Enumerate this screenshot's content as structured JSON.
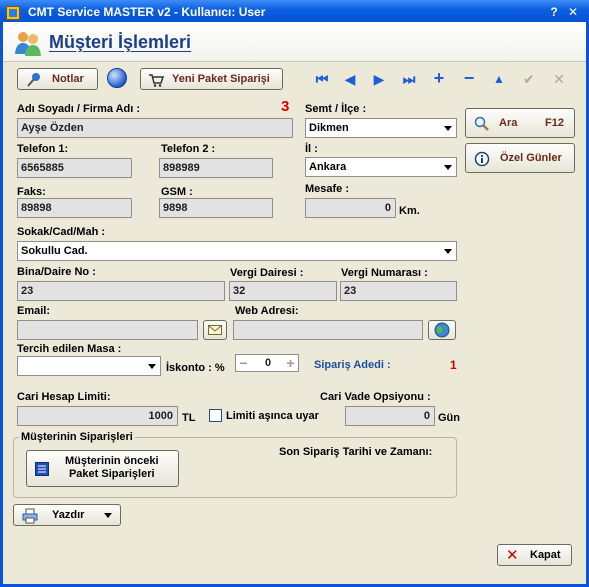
{
  "window": {
    "title": "CMT Service MASTER v2  -   Kullanıcı: User",
    "help": "?",
    "close": "✕"
  },
  "header": {
    "title": "Müşteri İşlemleri"
  },
  "toolbar": {
    "notes_label": "Notlar",
    "new_order_label": "Yeni Paket Siparişi",
    "nav": {
      "first": "⏮",
      "prev": "◀",
      "next": "▶",
      "last": "⏭",
      "add": "+",
      "remove": "−",
      "up": "▲",
      "confirm": "✔",
      "cancel": "✕"
    }
  },
  "form": {
    "name_label": "Adı Soyadı / Firma Adı :",
    "name_value": "Ayşe Özden",
    "count_badge": "3",
    "district_label": "Semt / İlçe :",
    "district_value": "Dikmen",
    "phone1_label": "Telefon 1:",
    "phone1_value": "6565885",
    "phone2_label": "Telefon 2 :",
    "phone2_value": "898989",
    "city_label": "İl :",
    "city_value": "Ankara",
    "fax_label": "Faks:",
    "fax_value": "89898",
    "gsm_label": "GSM :",
    "gsm_value": "9898",
    "distance_label": "Mesafe :",
    "distance_value": "0",
    "distance_unit": "Km.",
    "street_label": "Sokak/Cad/Mah :",
    "street_value": "Sokullu Cad.",
    "building_label": "Bina/Daire No :",
    "building_value": "23",
    "tax_office_label": "Vergi Dairesi :",
    "tax_office_value": "32",
    "tax_number_label": "Vergi Numarası :",
    "tax_number_value": "23",
    "email_label": "Email:",
    "email_value": "",
    "web_label": "Web Adresi:",
    "web_value": "",
    "table_label": "Tercih edilen Masa :",
    "table_value": "",
    "discount_label": "İskonto : %",
    "discount_value": "0",
    "order_count_label": "Sipariş Adedi :",
    "order_count_value": "1",
    "credit_limit_label": "Cari Hesap Limiti:",
    "credit_limit_value": "1000",
    "credit_unit": "TL",
    "limit_warn_label": "Limiti aşınca uyar",
    "due_label": "Cari Vade Opsiyonu :",
    "due_value": "0",
    "due_unit": "Gün"
  },
  "side_buttons": {
    "search_label": "Ara",
    "search_shortcut": "F12",
    "special_days_label": "Özel Günler"
  },
  "orders_group": {
    "title": "Müşterinin Siparişleri",
    "prev_orders_line1": "Müşterinin önceki",
    "prev_orders_line2": "Paket Siparişleri",
    "last_order_label": "Son Sipariş Tarihi ve Zamanı:"
  },
  "footer": {
    "print_label": "Yazdır",
    "close_label": "Kapat"
  },
  "colors": {
    "title_blue": "#0a5ee0",
    "accent_red": "#d40000",
    "label_blue": "#1d4f9c"
  }
}
